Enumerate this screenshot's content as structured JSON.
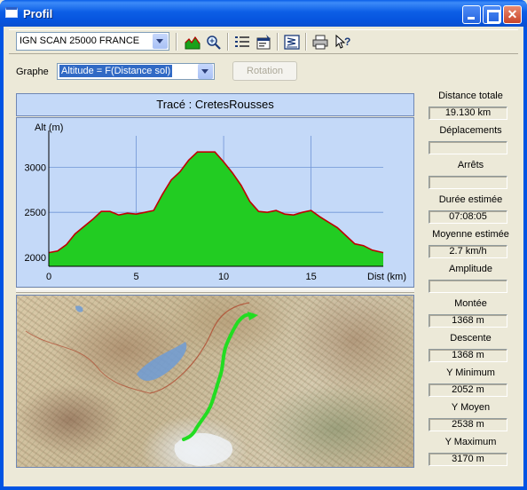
{
  "window": {
    "title": "Profil"
  },
  "toolbar": {
    "map_layer": "IGN SCAN 25000 FRANCE",
    "icons": [
      "profile-chart-icon",
      "zoom-icon",
      "list-icon",
      "properties-icon",
      "export-icon",
      "print-icon",
      "context-help-icon"
    ]
  },
  "graphe": {
    "label": "Graphe",
    "selected": "Altitude = F(Distance sol)",
    "rotation_label": "Rotation"
  },
  "chart_data": {
    "type": "area",
    "title": "Tracé : CretesRousses",
    "ylabel": "Alt (m)",
    "xlabel": "Dist (km)",
    "xlim": [
      0,
      19.13
    ],
    "ylim": [
      1900,
      3350
    ],
    "x_ticks": [
      "0",
      "5",
      "10",
      "15"
    ],
    "y_ticks": [
      "2000",
      "2500",
      "3000"
    ],
    "grid": true,
    "fill_color": "#22cc22",
    "line_color": "#c00000",
    "x": [
      0,
      0.5,
      1.0,
      1.5,
      2.0,
      2.5,
      3.0,
      3.5,
      4.0,
      4.5,
      5.0,
      5.5,
      6.0,
      6.5,
      7.0,
      7.5,
      8.0,
      8.5,
      9.0,
      9.5,
      10.0,
      10.5,
      11.0,
      11.5,
      12.0,
      12.5,
      13.0,
      13.5,
      14.0,
      14.5,
      15.0,
      15.5,
      16.0,
      16.5,
      17.0,
      17.5,
      18.0,
      18.5,
      19.13
    ],
    "y": [
      2052,
      2070,
      2140,
      2260,
      2340,
      2420,
      2510,
      2510,
      2470,
      2490,
      2480,
      2500,
      2520,
      2700,
      2860,
      2950,
      3080,
      3170,
      3170,
      3170,
      3060,
      2940,
      2800,
      2620,
      2510,
      2500,
      2520,
      2480,
      2470,
      2500,
      2520,
      2450,
      2390,
      2330,
      2240,
      2150,
      2130,
      2080,
      2052
    ]
  },
  "map": {
    "track_color": "#22dd22"
  },
  "stats": [
    {
      "label": "Distance totale",
      "value": "19.130 km"
    },
    {
      "label": "Déplacements",
      "value": ""
    },
    {
      "label": "Arrêts",
      "value": ""
    },
    {
      "label": "Durée estimée",
      "value": "07:08:05"
    },
    {
      "label": "Moyenne estimée",
      "value": "2.7 km/h"
    },
    {
      "label": "Amplitude",
      "value": ""
    },
    {
      "label": "Montée",
      "value": "1368 m"
    },
    {
      "label": "Descente",
      "value": "1368 m"
    },
    {
      "label": "Y Minimum",
      "value": "2052 m"
    },
    {
      "label": "Y Moyen",
      "value": "2538 m"
    },
    {
      "label": "Y Maximum",
      "value": "3170 m"
    }
  ]
}
